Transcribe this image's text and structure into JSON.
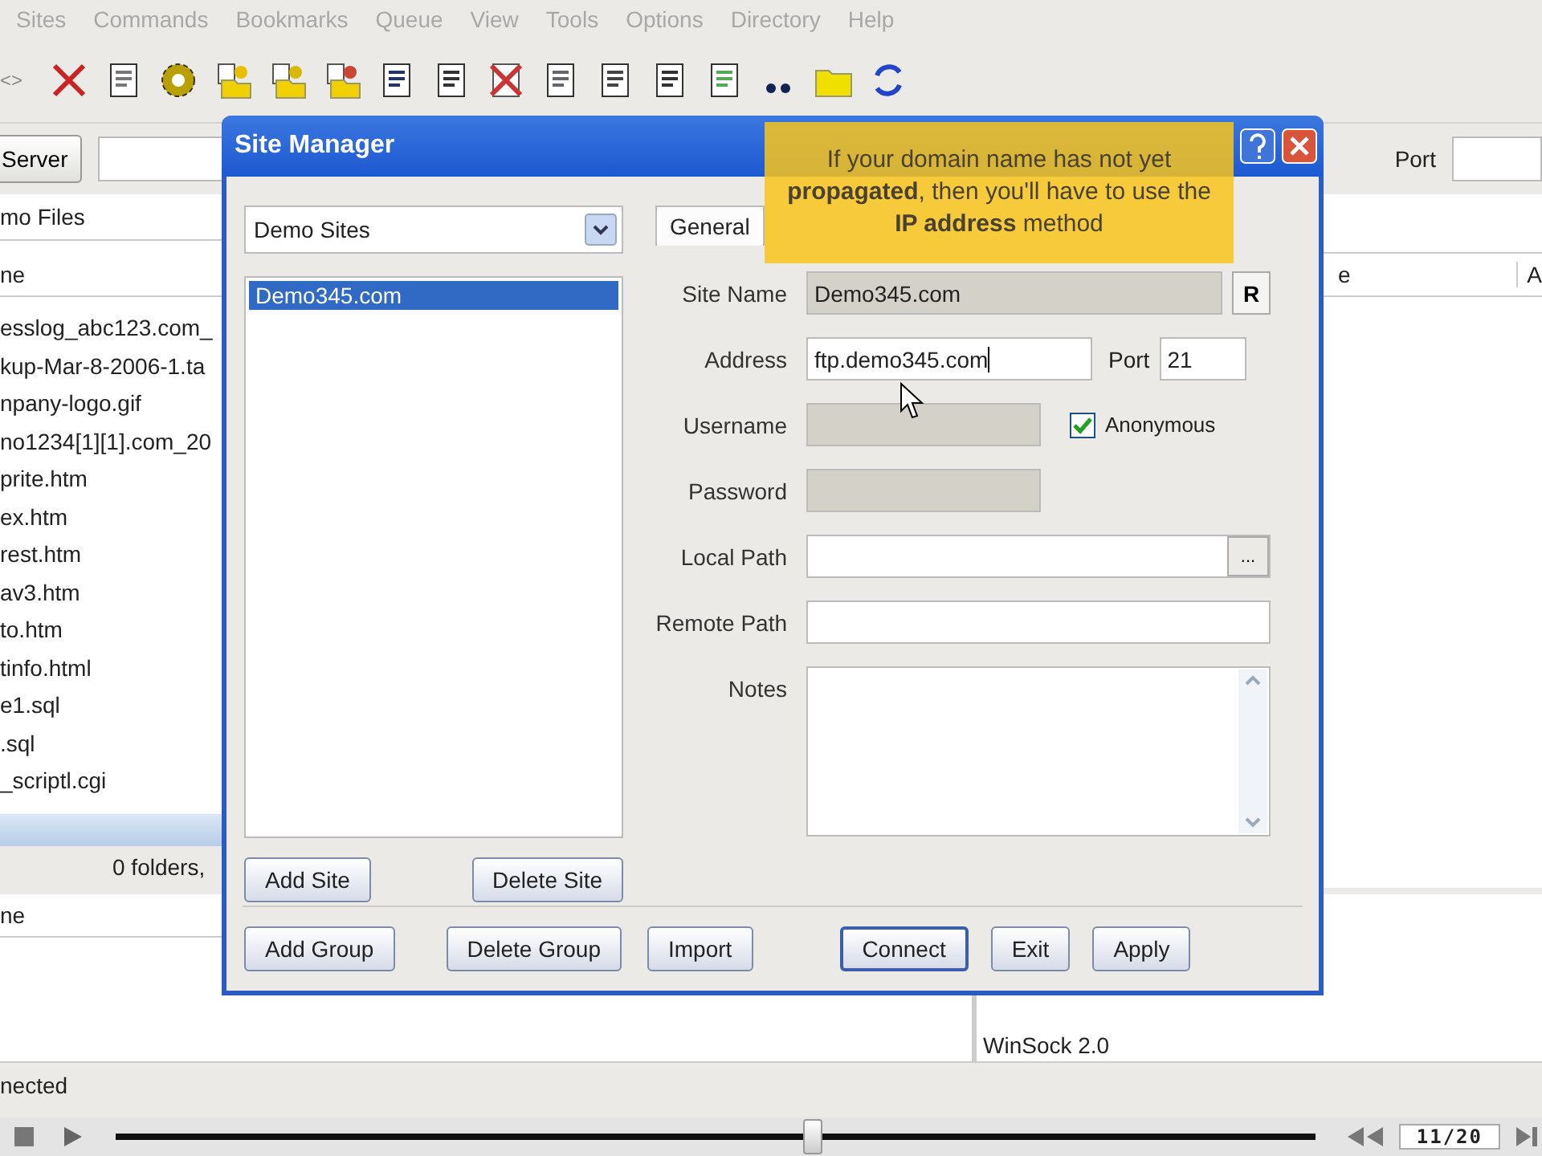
{
  "menu": [
    "Sites",
    "Commands",
    "Bookmarks",
    "Queue",
    "View",
    "Tools",
    "Options",
    "Directory",
    "Help"
  ],
  "toolbar": {
    "cut_text": "<>"
  },
  "connect_bar": {
    "server_button": "Server",
    "port_label": "Port"
  },
  "local_pane": {
    "path": "mo Files",
    "column": "ne",
    "files": [
      "esslog_abc123.com_",
      "kup-Mar-8-2006-1.ta",
      "npany-logo.gif",
      "no1234[1][1].com_20",
      "prite.htm",
      "ex.htm",
      "rest.htm",
      "av3.htm",
      "to.htm",
      "tinfo.html",
      "e1.sql",
      ".sql",
      "_scriptl.cgi"
    ],
    "summary": "0 folders,"
  },
  "remote_pane": {
    "columns": [
      "e",
      "A"
    ]
  },
  "queue_pane": {
    "column": "ne"
  },
  "log": {
    "lines": [
      "WinSock 2.0"
    ]
  },
  "status_bar": {
    "text": "nected"
  },
  "dialog": {
    "title": "Site Manager",
    "group_combo": "Demo Sites",
    "sites": [
      {
        "name": "Demo345.com",
        "selected": true
      }
    ],
    "site_buttons": [
      {
        "label": "Add Site",
        "default": false
      },
      {
        "label": "Delete Site",
        "default": false
      }
    ],
    "tabs": [
      {
        "label": "General",
        "selected": true
      }
    ],
    "fields": [
      {
        "kind": "text",
        "label": "Site Name",
        "value": "Demo345.com",
        "disabled": true,
        "side_button": "R"
      },
      {
        "kind": "address",
        "label": "Address",
        "value": "ftp.demo345.com",
        "disabled": false,
        "port_label": "Port",
        "port": "21"
      },
      {
        "kind": "username",
        "label": "Username",
        "disabled": true,
        "checkbox": {
          "label": "Anonymous",
          "checked": true
        }
      },
      {
        "kind": "short",
        "label": "Password",
        "disabled": true
      },
      {
        "kind": "browse",
        "label": "Local Path",
        "disabled": false,
        "side_button": "..."
      },
      {
        "kind": "text",
        "label": "Remote Path",
        "disabled": false
      },
      {
        "kind": "notes",
        "label": "Notes",
        "disabled": false
      }
    ],
    "buttons": [
      {
        "label": "Add Group",
        "default": false
      },
      {
        "label": "Delete Group",
        "default": false
      },
      {
        "label": "Import",
        "default": false
      },
      {
        "label": "Connect",
        "default": true
      },
      {
        "label": "Exit",
        "default": false
      },
      {
        "label": "Apply",
        "default": false
      }
    ]
  },
  "callout": {
    "text": "If your domain name has not yet **propagated**, then you'll have to use the **IP address** method"
  },
  "player": {
    "level": 0.58,
    "counter": "11/20"
  }
}
